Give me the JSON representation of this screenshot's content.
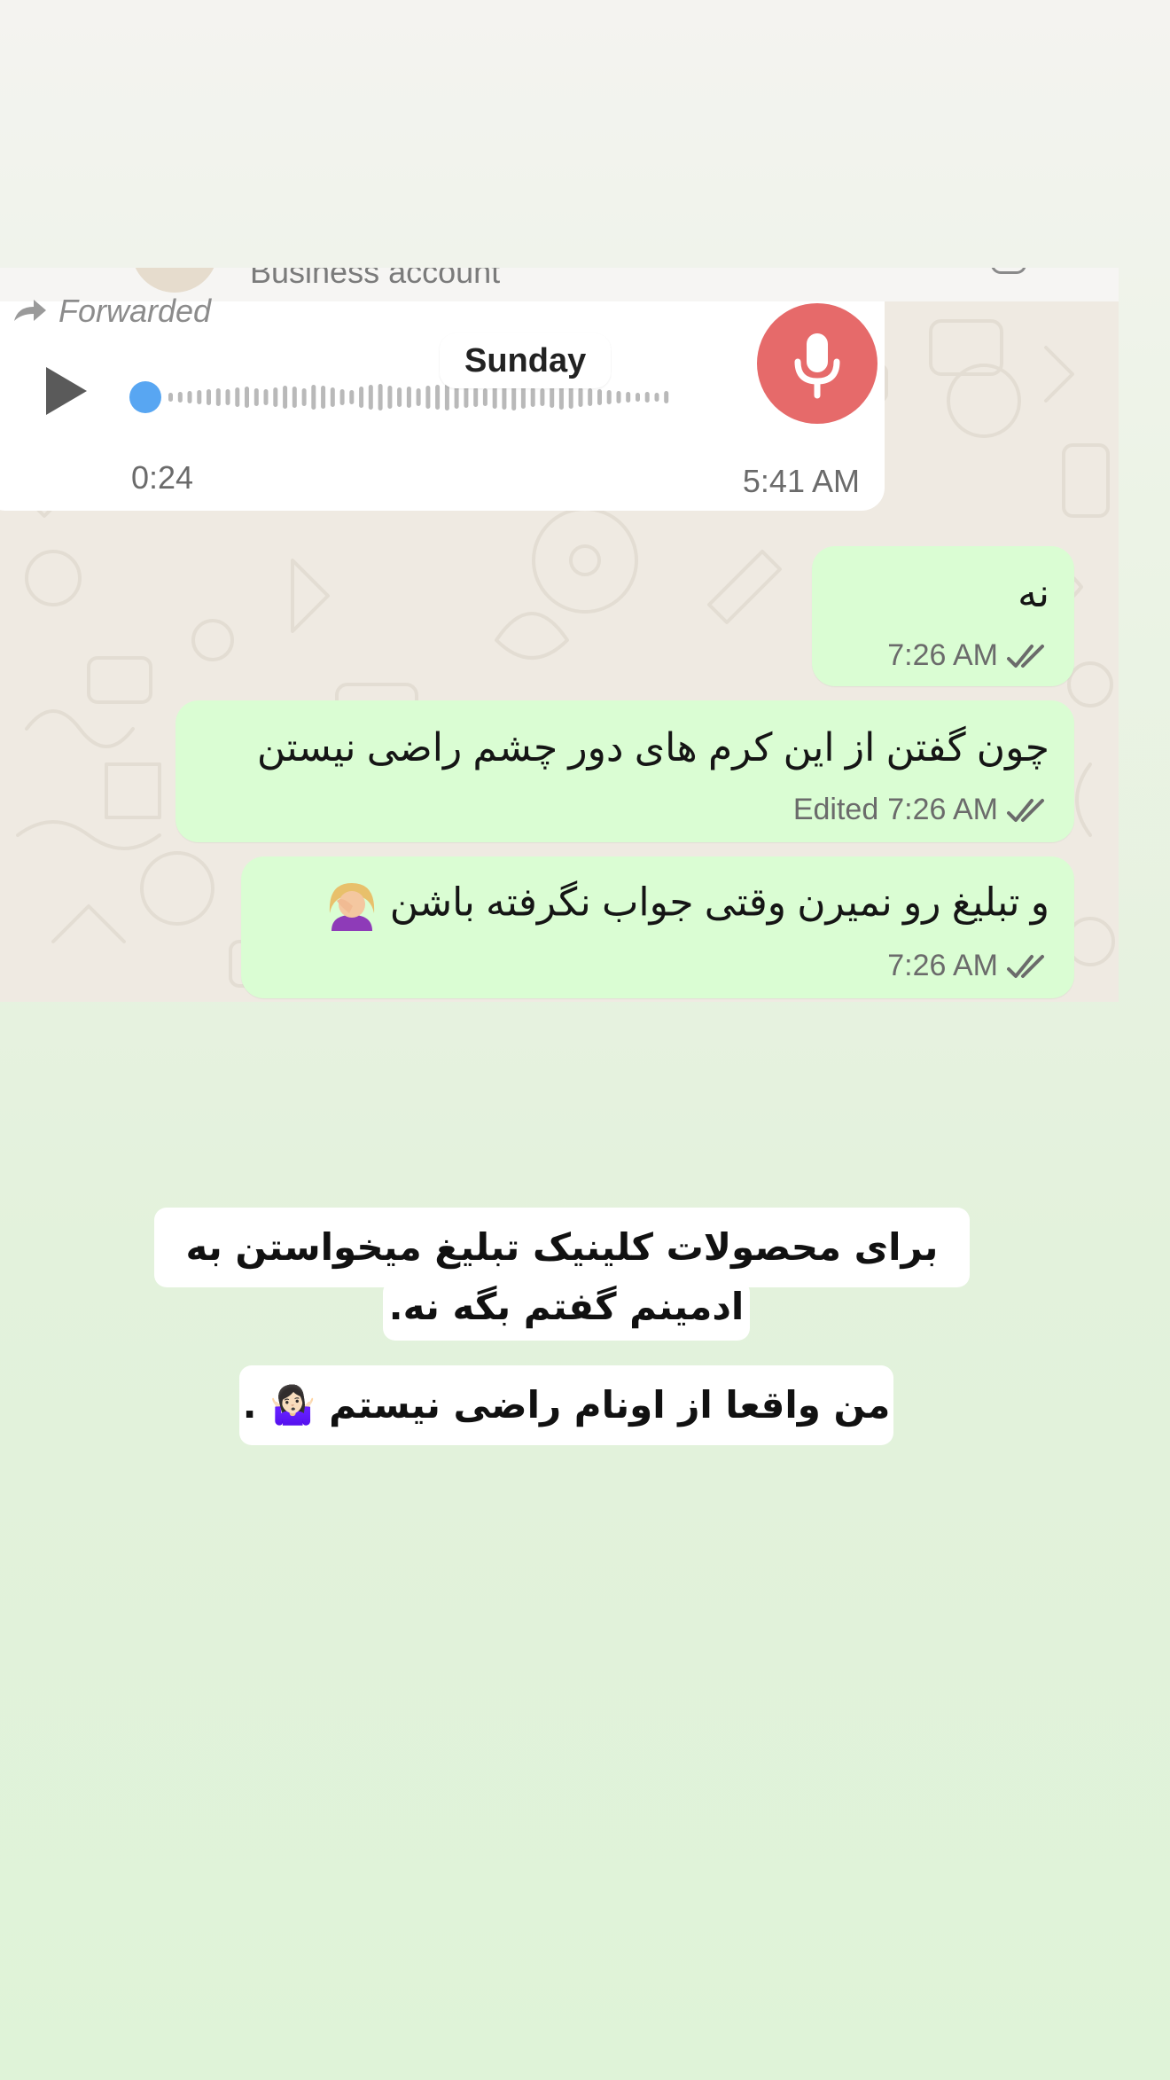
{
  "chat": {
    "header_subtitle": "Business account",
    "voice_message": {
      "forwarded_label": "Forwarded",
      "duration": "0:24",
      "time": "5:41 AM",
      "progress": 0
    },
    "date_divider": "Sunday",
    "messages": [
      {
        "text": "نه",
        "time": "7:26 AM",
        "edited_label": "",
        "emoji": ""
      },
      {
        "text": "چون گفتن از این کرم های دور چشم راضی نیستن",
        "time": "7:26 AM",
        "edited_label": "Edited",
        "emoji": ""
      },
      {
        "text": "و تبلیغ رو نمیرن وقتی جواب نگرفته باشن",
        "time": "7:26 AM",
        "edited_label": "",
        "emoji": "face-palm"
      }
    ]
  },
  "story_caption": {
    "line1": "برای محصولات کلینیک تبلیغ میخواستن به",
    "line2": "ادمینم گفتم بگه نه.",
    "line3": "من واقعا از اونام راضی نیستم 🤷🏻‍♀️ ."
  },
  "colors": {
    "outgoing_bubble": "#dafdd3",
    "mic_badge": "#e66a6a",
    "scrub_dot": "#58a6f2"
  }
}
